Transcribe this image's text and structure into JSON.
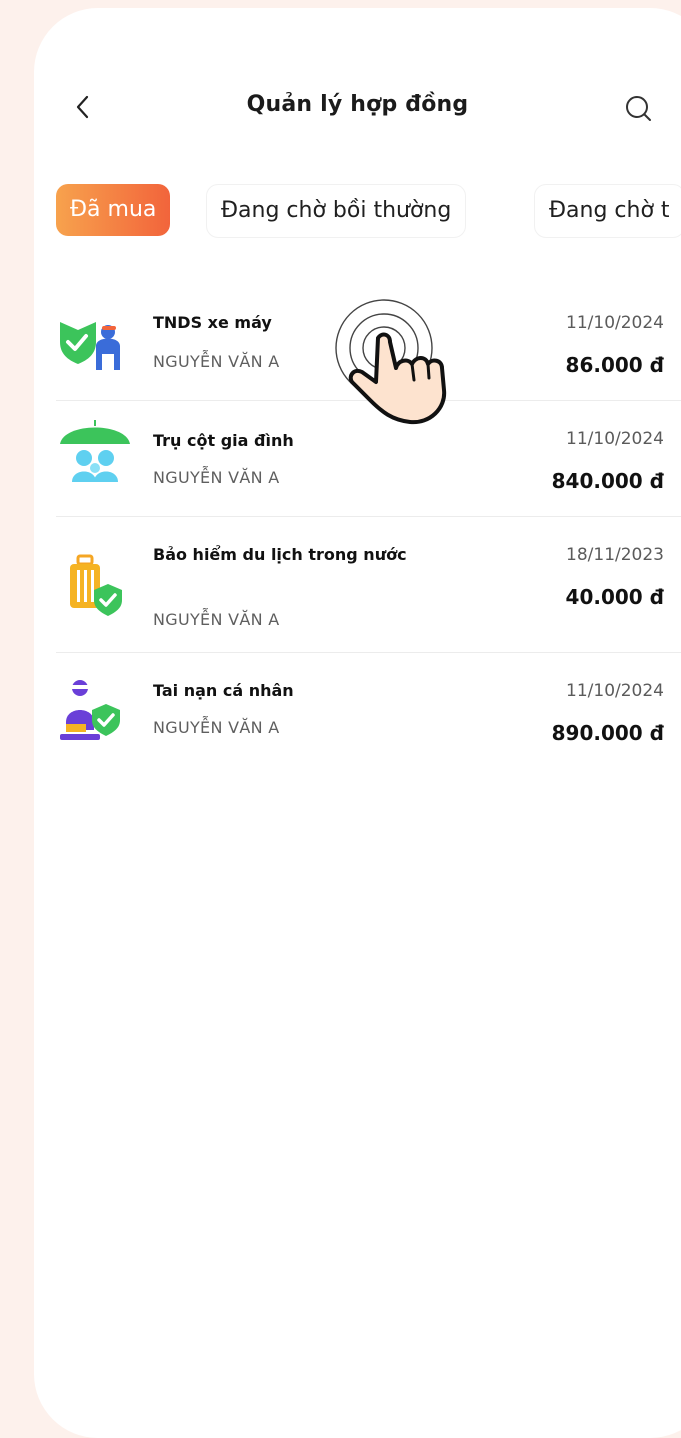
{
  "header": {
    "title": "Quản lý hợp đồng",
    "back_icon": "chevron-left-icon",
    "search_icon": "search-icon"
  },
  "tabs": [
    {
      "label": "Đã mua",
      "active": true
    },
    {
      "label": "Đang chờ bồi thường",
      "active": false
    },
    {
      "label": "Đang chờ t",
      "active": false
    }
  ],
  "contracts": [
    {
      "name": "TNDS xe máy",
      "owner": "NGUYỄN VĂN A",
      "date": "11/10/2024",
      "price": "86.000 đ",
      "icon": "motorbike-shield-icon"
    },
    {
      "name": "Trụ cột gia đình",
      "owner": "NGUYỄN VĂN A",
      "date": "11/10/2024",
      "price": "840.000 đ",
      "icon": "family-umbrella-icon"
    },
    {
      "name": "Bảo hiểm du lịch trong nước",
      "owner": "NGUYỄN VĂN A",
      "date": "18/11/2023",
      "price": "40.000 đ",
      "icon": "luggage-shield-icon"
    },
    {
      "name": "Tai nạn cá nhân",
      "owner": "NGUYỄN VĂN A",
      "date": "11/10/2024",
      "price": "890.000 đ",
      "icon": "injured-person-shield-icon"
    }
  ],
  "overlay": {
    "icon": "tap-hand-icon"
  },
  "colors": {
    "accent_start": "#f7a24d",
    "accent_end": "#f2643b",
    "shield_green": "#3cc45b",
    "brand_blue": "#3a6cd9",
    "page_bg": "#fdf1ec"
  }
}
